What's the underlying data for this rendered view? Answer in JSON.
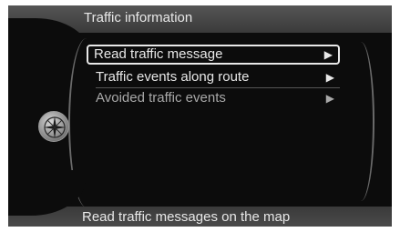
{
  "header": {
    "title": "Traffic information"
  },
  "menu": {
    "items": [
      {
        "label": "Read traffic message",
        "arrow": "▶"
      },
      {
        "label": "Traffic events along route",
        "arrow": "▶"
      },
      {
        "label": "Avoided traffic events",
        "arrow": "▶"
      }
    ]
  },
  "footer": {
    "hint": "Read traffic messages on the map"
  },
  "icons": {
    "side": "compass-icon"
  }
}
